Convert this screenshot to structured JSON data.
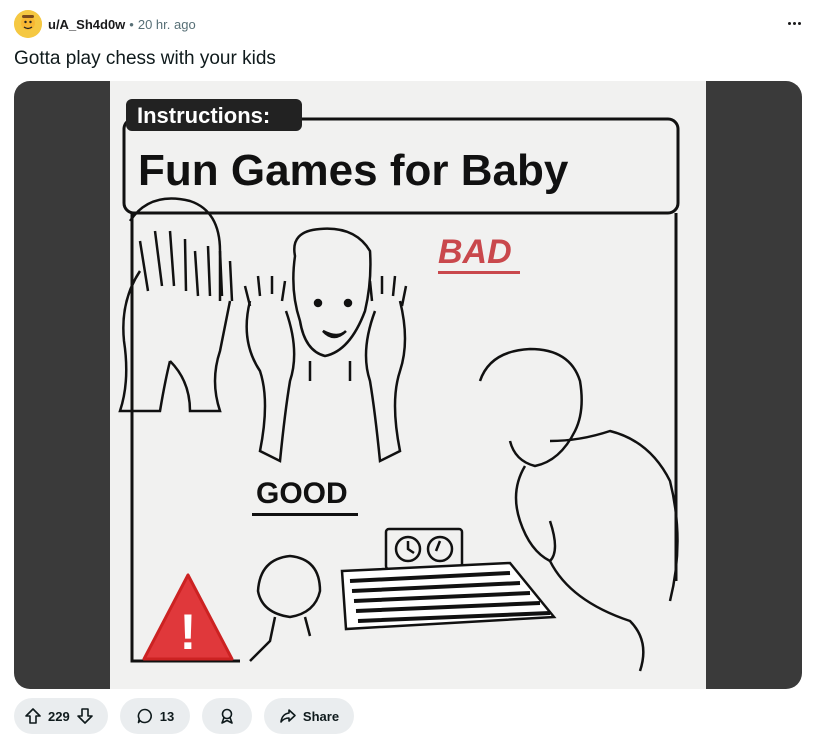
{
  "post": {
    "username": "u/A_Sh4d0w",
    "separator": "•",
    "time": "20 hr. ago",
    "title": "Gotta play chess with your kids"
  },
  "image": {
    "header_tab": "Instructions:",
    "heading": "Fun Games for Baby",
    "bad_label": "BAD",
    "good_label": "GOOD",
    "warning_symbol": "!",
    "colors": {
      "warning_red": "#e0383b",
      "bad_red": "#c9484c"
    }
  },
  "actions": {
    "upvote_icon": "arrow-up-icon",
    "vote_count": "229",
    "downvote_icon": "arrow-down-icon",
    "comment_icon": "comment-bubble-icon",
    "comment_count": "13",
    "award_icon": "award-icon",
    "share_icon": "share-arrow-icon",
    "share_label": "Share"
  }
}
